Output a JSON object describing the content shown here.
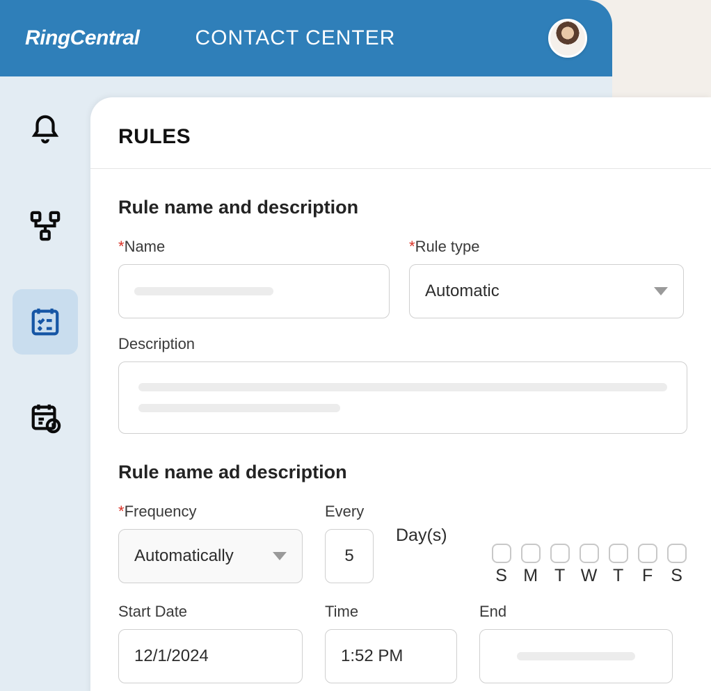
{
  "header": {
    "brand": "RingCentral",
    "title": "CONTACT CENTER"
  },
  "sidebar": {
    "items": [
      {
        "name": "notifications",
        "active": false
      },
      {
        "name": "workflow",
        "active": false
      },
      {
        "name": "rules",
        "active": true
      },
      {
        "name": "schedule",
        "active": false
      }
    ]
  },
  "panel": {
    "title": "RULES",
    "section1": {
      "heading": "Rule name and description",
      "name_label": "Name",
      "name_value": "",
      "ruletype_label": "Rule type",
      "ruletype_value": "Automatic",
      "description_label": "Description",
      "description_value": ""
    },
    "section2": {
      "heading": "Rule name ad description",
      "frequency_label": "Frequency",
      "frequency_value": "Automatically",
      "every_label": "Every",
      "every_value": "5",
      "unit_label": "Day(s)",
      "dow": [
        "S",
        "M",
        "T",
        "W",
        "T",
        "F",
        "S"
      ],
      "start_label": "Start Date",
      "start_value": "12/1/2024",
      "time_label": "Time",
      "time_value": "1:52 PM",
      "end_label": "End",
      "end_value": ""
    }
  }
}
